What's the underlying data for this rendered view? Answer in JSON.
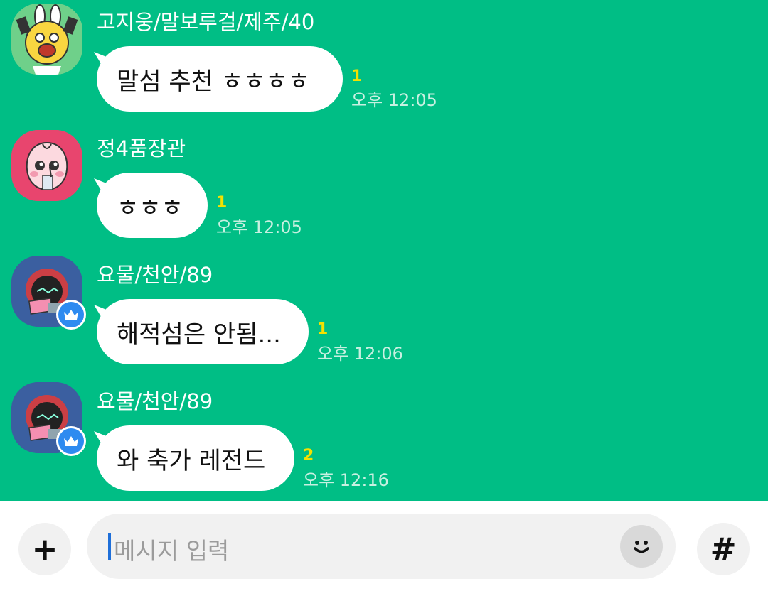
{
  "messages": [
    {
      "sender": "고지웅/말보루걸/제주/40",
      "text": "말섬 추천 ㅎㅎㅎㅎ",
      "unread": "1",
      "time": "오후 12:05",
      "avatar": "ryan-rabbit-avatar"
    },
    {
      "sender": "정4품장관",
      "text": "ㅎㅎㅎ",
      "unread": "1",
      "time": "오후 12:05",
      "avatar": "apeach-avatar"
    },
    {
      "sender": "요물/천안/89",
      "text": "해적섬은 안됨...",
      "unread": "1",
      "time": "오후 12:06",
      "avatar": "angry-laptop-avatar",
      "host_badge": "crown-icon"
    },
    {
      "sender": "요물/천안/89",
      "text": "와 축가 레전드",
      "unread": "2",
      "time": "오후 12:16",
      "avatar": "angry-laptop-avatar",
      "host_badge": "crown-icon"
    }
  ],
  "input": {
    "placeholder": "메시지 입력",
    "add_label": "+",
    "hashtag_label": "#"
  },
  "colors": {
    "chat_background": "#00BE85",
    "bubble": "#FFFFFF",
    "unread": "#F5E100",
    "timestamp": "#C8F0E1",
    "host_badge": "#2E8BF0"
  }
}
